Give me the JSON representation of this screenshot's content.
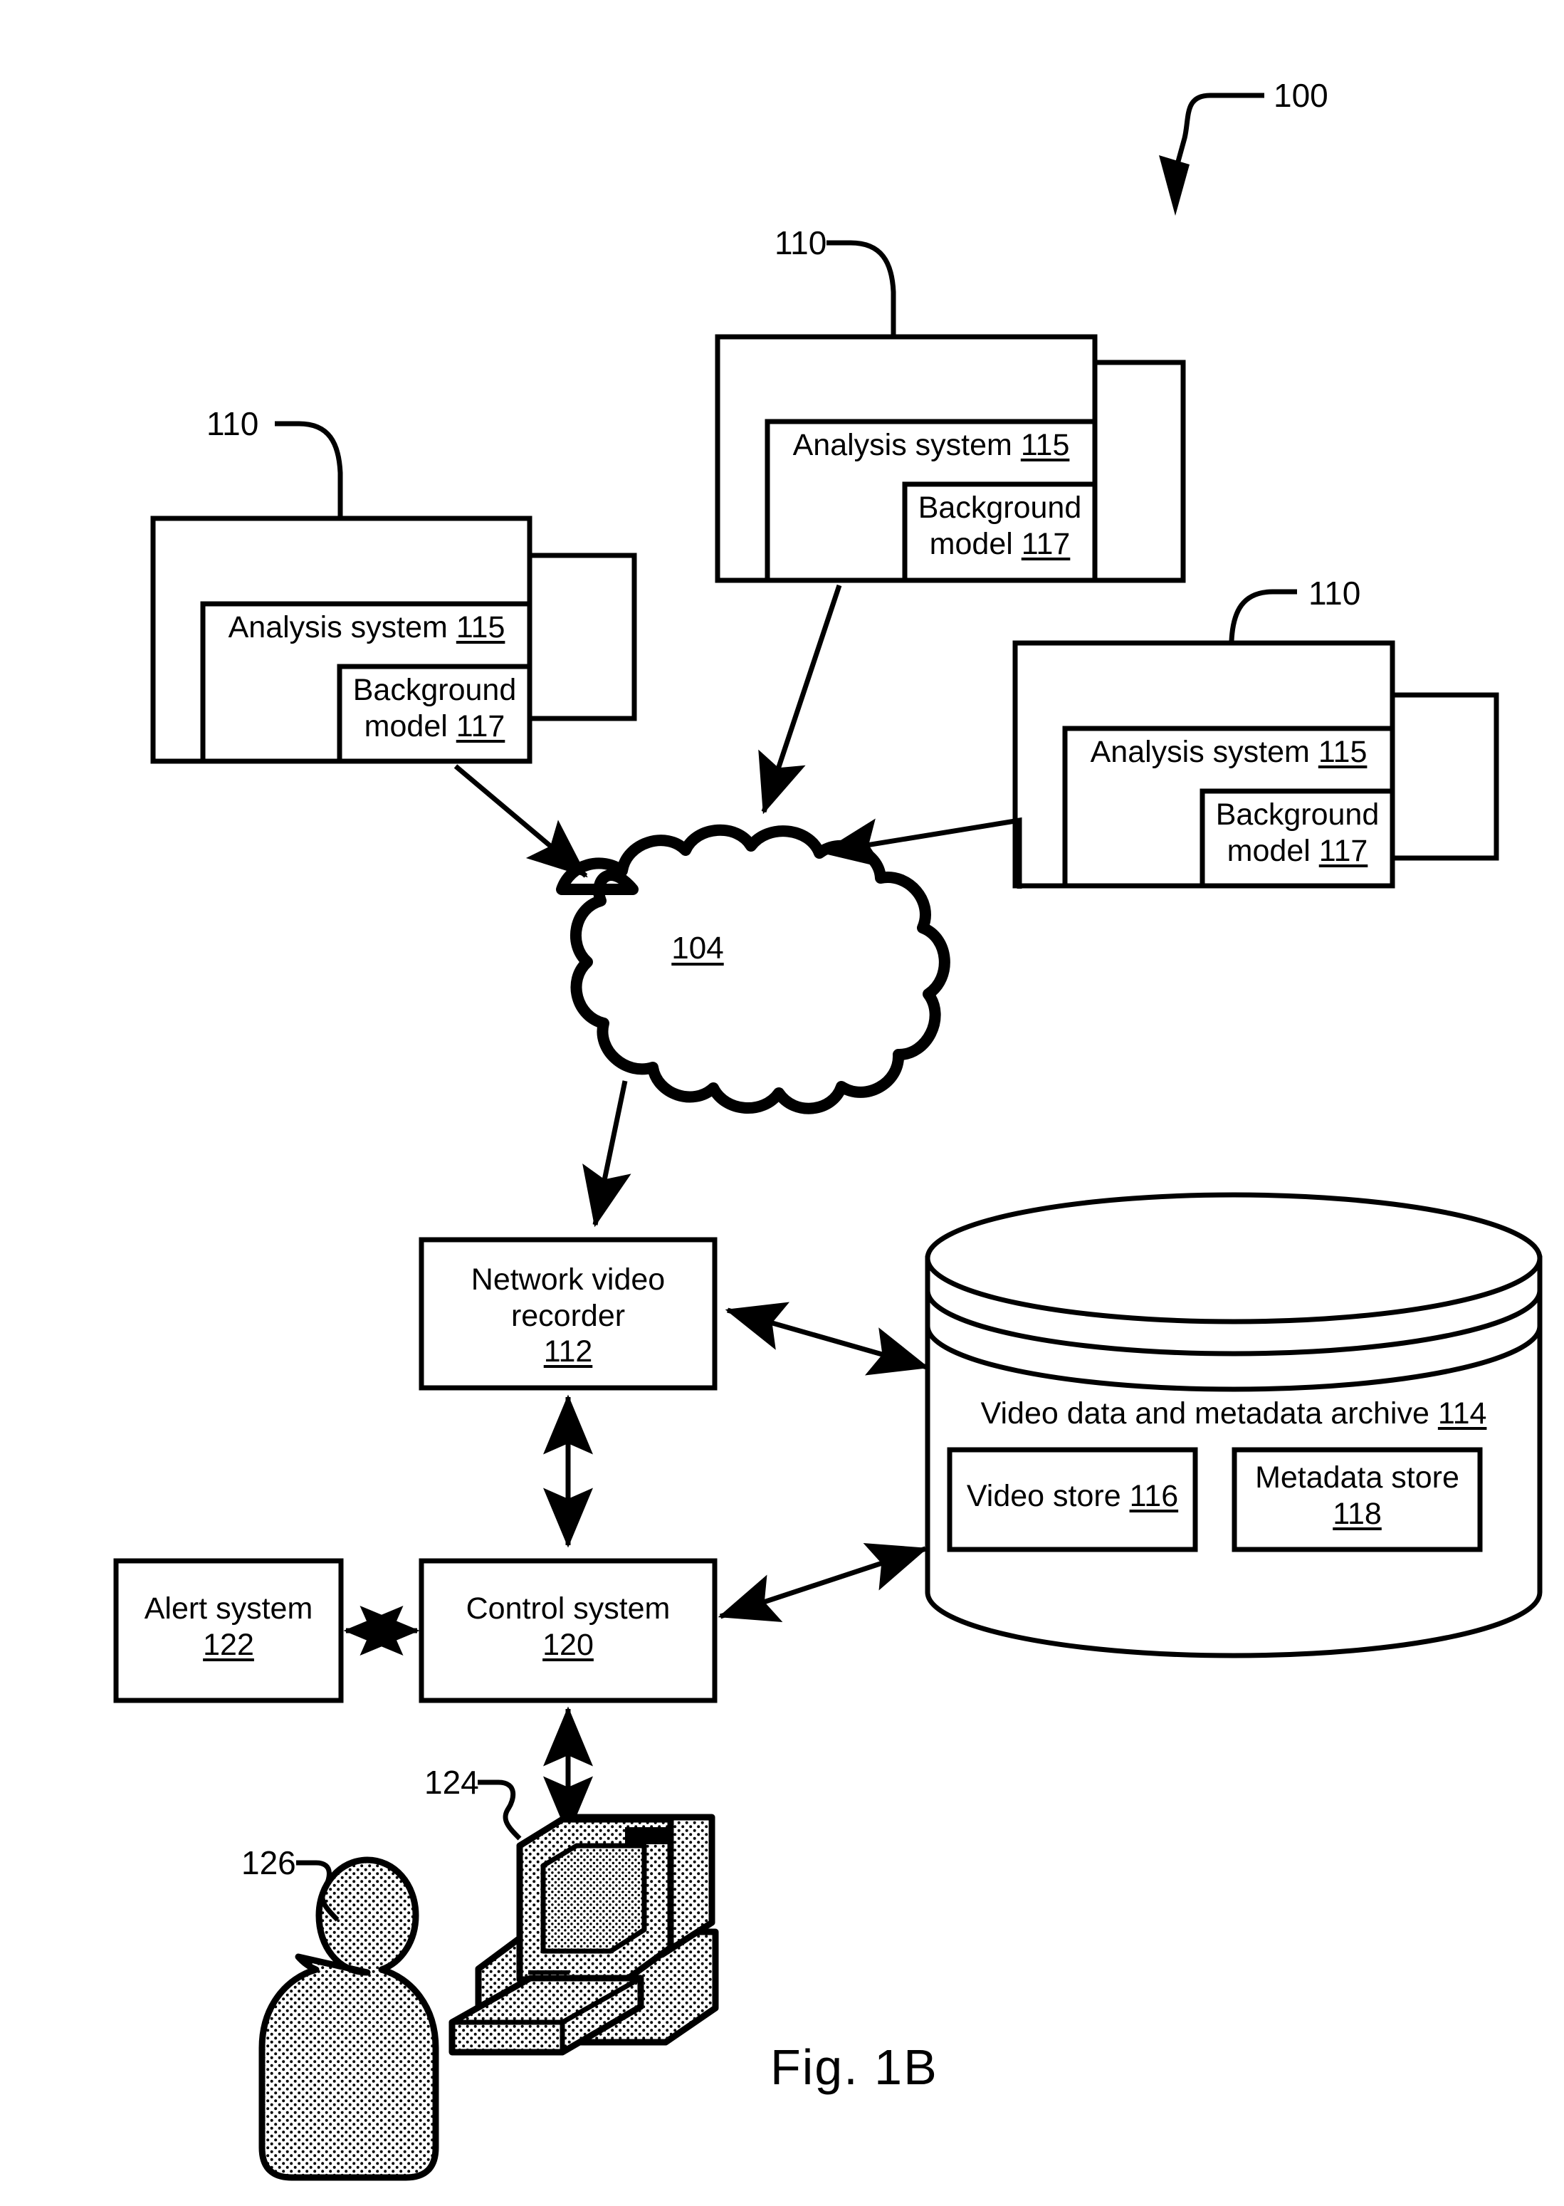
{
  "figure": {
    "caption": "Fig. 1B",
    "system_ref": "100"
  },
  "nodes": {
    "analysis_left": {
      "ref": "110",
      "inner_title": "Analysis system",
      "inner_ref": "115",
      "model_line1": "Background",
      "model_line2": "model",
      "model_ref": "117"
    },
    "analysis_top": {
      "ref": "110",
      "inner_title": "Analysis system",
      "inner_ref": "115",
      "model_line1": "Background",
      "model_line2": "model",
      "model_ref": "117"
    },
    "analysis_right": {
      "ref": "110",
      "inner_title": "Analysis system",
      "inner_ref": "115",
      "model_line1": "Background",
      "model_line2": "model",
      "model_ref": "117"
    },
    "network": {
      "ref": "104"
    },
    "nvr": {
      "line1": "Network video",
      "line2": "recorder",
      "ref": "112"
    },
    "archive": {
      "title": "Video data and metadata archive",
      "ref": "114",
      "video_store": {
        "label": "Video store",
        "ref": "116"
      },
      "metadata_store": {
        "label": "Metadata store",
        "ref": "118"
      }
    },
    "alert_system": {
      "label": "Alert system",
      "ref": "122"
    },
    "control_system": {
      "label": "Control system",
      "ref": "120"
    },
    "workstation": {
      "ref": "124"
    },
    "operator": {
      "ref": "126"
    }
  },
  "colors": {
    "ink": "#000000",
    "paper": "#ffffff",
    "stipple": "#000000"
  }
}
